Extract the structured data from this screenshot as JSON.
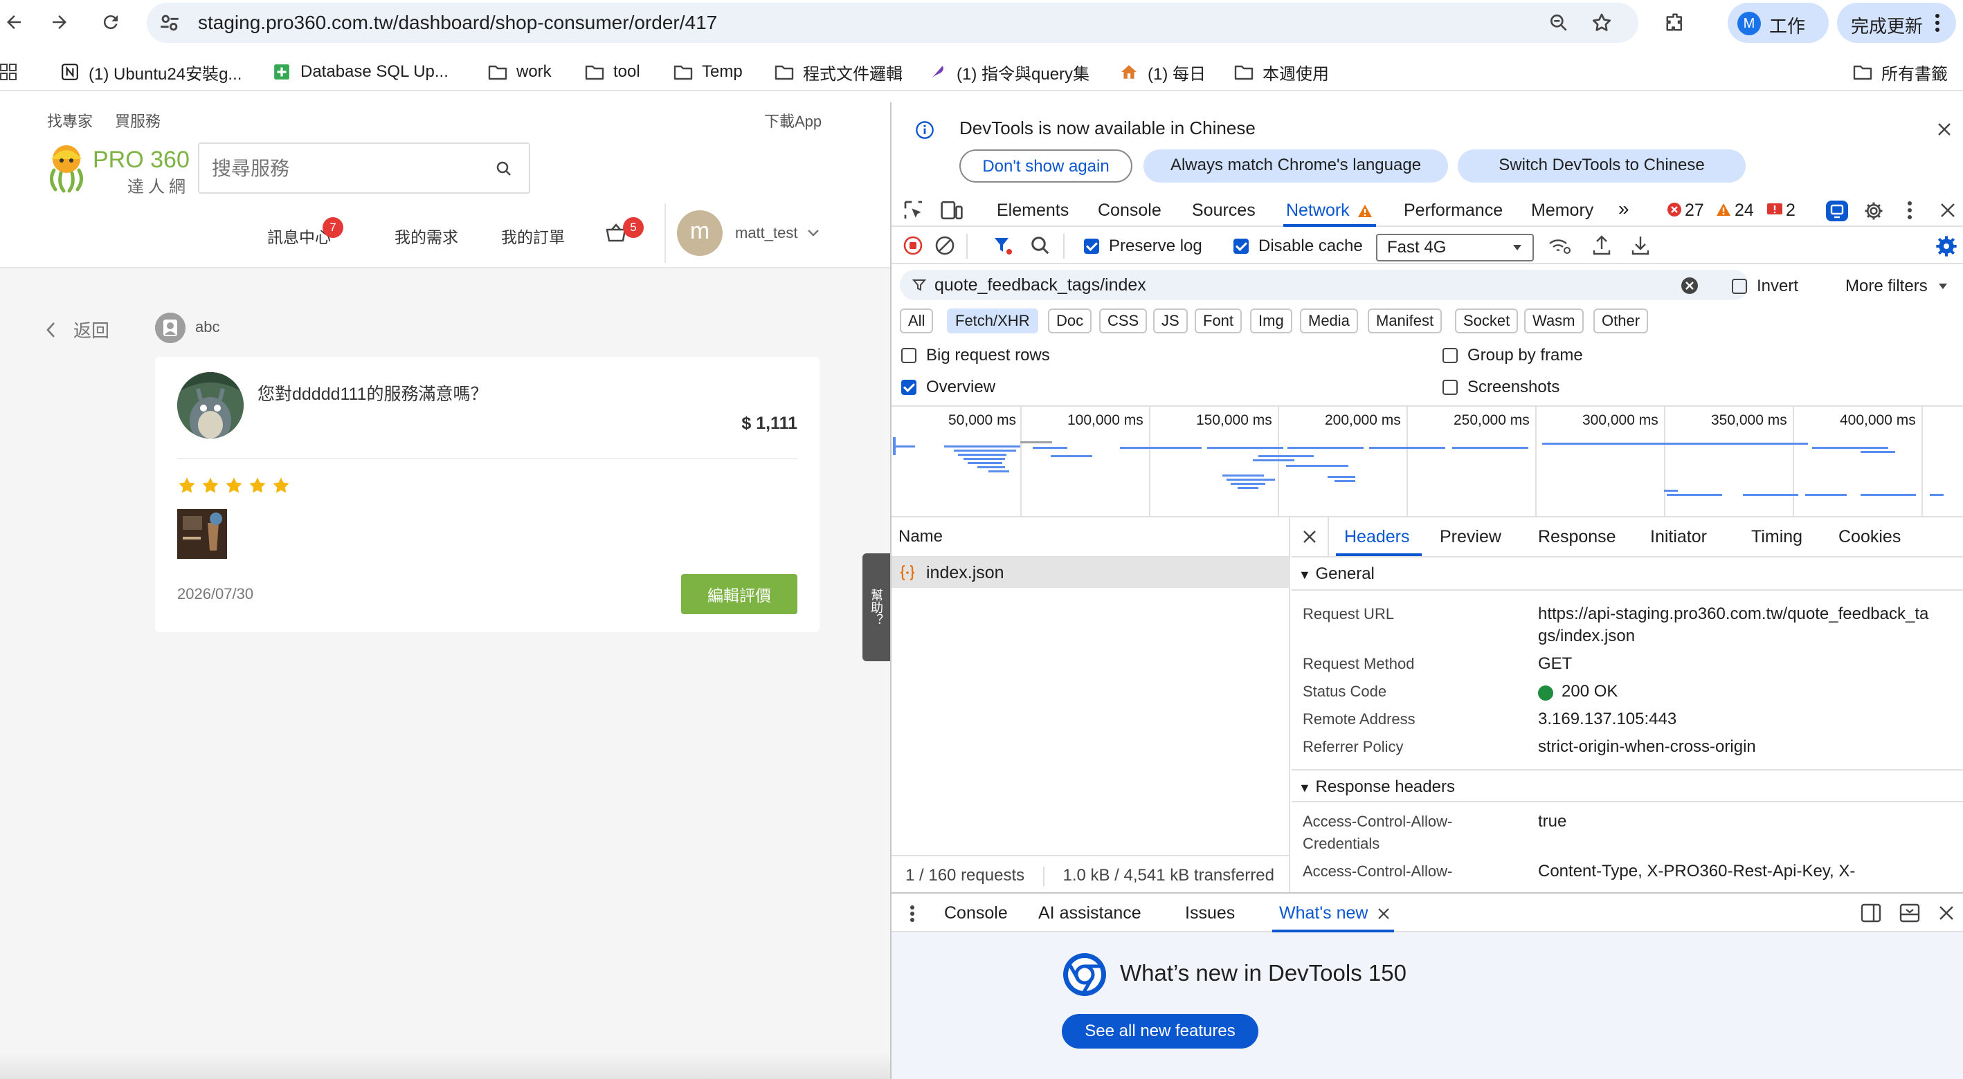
{
  "browser": {
    "url": "staging.pro360.com.tw/dashboard/shop-consumer/order/417",
    "profile_initial": "M",
    "profile_label": "工作",
    "update_label": "完成更新"
  },
  "bookmarks": {
    "items": [
      {
        "label": "(1) Ubuntu24安裝g..."
      },
      {
        "label": "Database SQL Up..."
      },
      {
        "label": "work"
      },
      {
        "label": "tool"
      },
      {
        "label": "Temp"
      },
      {
        "label": "程式文件邏輯"
      },
      {
        "label": "(1) 指令與query集"
      },
      {
        "label": "(1) 每日"
      },
      {
        "label": "本週使用"
      }
    ],
    "all_bookmarks": "所有書籤"
  },
  "site": {
    "top_links": [
      "找專家",
      "買服務"
    ],
    "download_app": "下載App",
    "logo_text": "PRO 360",
    "logo_sub": "達人網",
    "search_placeholder": "搜尋服務",
    "nav": {
      "messages": "訊息中心",
      "messages_badge": "7",
      "needs": "我的需求",
      "orders": "我的訂單",
      "cart_badge": "5"
    },
    "user_initial": "m",
    "username": "matt_test"
  },
  "review": {
    "back": "返回",
    "author": "abc",
    "question": "您對ddddd111的服務滿意嗎？",
    "price": "$ 1,111",
    "rating": 5,
    "date": "2026/07/30",
    "edit_button": "編輯評價"
  },
  "help_tab": "幫助？",
  "devtools": {
    "infobar": {
      "message": "DevTools is now available in Chinese",
      "dont_show": "Don't show again",
      "always_match": "Always match Chrome's language",
      "switch": "Switch DevTools to Chinese"
    },
    "tabs": [
      "Elements",
      "Console",
      "Sources",
      "Network",
      "Performance",
      "Memory"
    ],
    "active_tab": "Network",
    "errors": "27",
    "warnings": "24",
    "issues": "2",
    "preserve_log": "Preserve log",
    "disable_cache": "Disable cache",
    "throttle": "Fast 4G",
    "filter_value": "quote_feedback_tags/index",
    "invert": "Invert",
    "more_filters": "More filters",
    "type_filters": [
      "All",
      "Fetch/XHR",
      "Doc",
      "CSS",
      "JS",
      "Font",
      "Img",
      "Media",
      "Manifest",
      "Socket",
      "Wasm",
      "Other"
    ],
    "active_type": "Fetch/XHR",
    "options": {
      "big_rows": "Big request rows",
      "group_by_frame": "Group by frame",
      "overview": "Overview",
      "screenshots": "Screenshots"
    },
    "timeline_ticks": [
      "50,000 ms",
      "100,000 ms",
      "150,000 ms",
      "200,000 ms",
      "250,000 ms",
      "300,000 ms",
      "350,000 ms",
      "400,000 ms"
    ],
    "name_header": "Name",
    "request_name": "index.json",
    "summary_requests": "1 / 160 requests",
    "summary_transferred": "1.0 kB / 4,541 kB transferred",
    "detail_tabs": [
      "Headers",
      "Preview",
      "Response",
      "Initiator",
      "Timing",
      "Cookies"
    ],
    "active_detail_tab": "Headers",
    "general_title": "General",
    "general": [
      {
        "key": "Request URL",
        "value": "https://api-staging.pro360.com.tw/quote_feedback_ta",
        "value2": "gs/index.json"
      },
      {
        "key": "Request Method",
        "value": "GET"
      },
      {
        "key": "Status Code",
        "value": "200 OK"
      },
      {
        "key": "Remote Address",
        "value": "3.169.137.105:443"
      },
      {
        "key": "Referrer Policy",
        "value": "strict-origin-when-cross-origin"
      }
    ],
    "response_headers_title": "Response headers",
    "response_headers": [
      {
        "key": "Access-Control-Allow-",
        "key2": "Credentials",
        "value": "true"
      },
      {
        "key": "Access-Control-Allow-",
        "value": "Content-Type, X-PRO360-Rest-Api-Key, X-"
      }
    ],
    "drawer_tabs": [
      "Console",
      "AI assistance",
      "Issues",
      "What's new"
    ],
    "active_drawer_tab": "What's new",
    "whats_new_title": "What’s new in DevTools 150",
    "see_all": "See all new features"
  },
  "colors": {
    "accent_green": "#7cb342",
    "star": "#f5b50a",
    "badge_red": "#e53935",
    "chrome_blue": "#0b57d0"
  }
}
